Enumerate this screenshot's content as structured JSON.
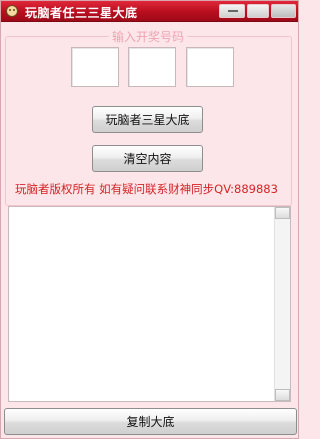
{
  "window": {
    "title": "玩脑者任三三星大底",
    "icons": {
      "app": "app-icon",
      "minimize": "minimize-icon",
      "maximize": "maximize-icon",
      "close": "close-icon"
    }
  },
  "input_group": {
    "legend": "输入开奖号码",
    "boxes": [
      "",
      "",
      ""
    ]
  },
  "buttons": {
    "generate": "玩脑者三星大底",
    "clear": "清空内容",
    "copy": "复制大底"
  },
  "copyright": "玩脑者版权所有 如有疑问联系财神同步QV:889883",
  "output": {
    "value": ""
  },
  "colors": {
    "titlebar": "#c0142a",
    "background": "#fde6ea",
    "notice_text": "#d42424",
    "legend_text": "#eea4b1"
  }
}
